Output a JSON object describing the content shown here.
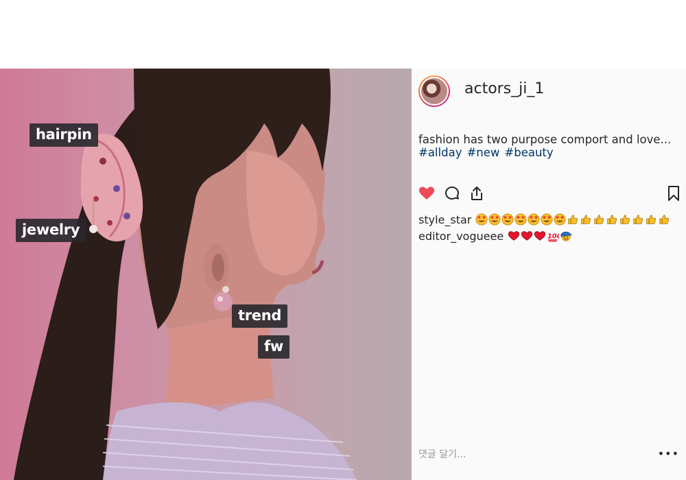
{
  "post": {
    "username": "actors_ji_1",
    "caption": "fashion has two purpose comport  and love...",
    "hashtags": [
      "#allday",
      "#new",
      "#beauty"
    ],
    "tags": [
      {
        "label": "hairpin"
      },
      {
        "label": "jewelry"
      },
      {
        "label": "trend"
      },
      {
        "label": "fw"
      }
    ],
    "liked": true,
    "like_color": "#ed4956"
  },
  "comments": [
    {
      "user": "style_star",
      "emojis": [
        "heart-eyes",
        "heart-eyes",
        "heart-eyes",
        "heart-eyes",
        "heart-eyes",
        "heart-eyes",
        "heart-eyes",
        "thumbs-up",
        "thumbs-up",
        "thumbs-up",
        "thumbs-up",
        "thumbs-up",
        "thumbs-up",
        "thumbs-up",
        "thumbs-up"
      ]
    },
    {
      "user": "editor_vogueee",
      "emojis": [
        "red-heart",
        "red-heart",
        "red-heart",
        "hundred",
        "face-with-cap"
      ]
    }
  ],
  "composer": {
    "placeholder": "댓글 달기...",
    "more": "•••"
  }
}
